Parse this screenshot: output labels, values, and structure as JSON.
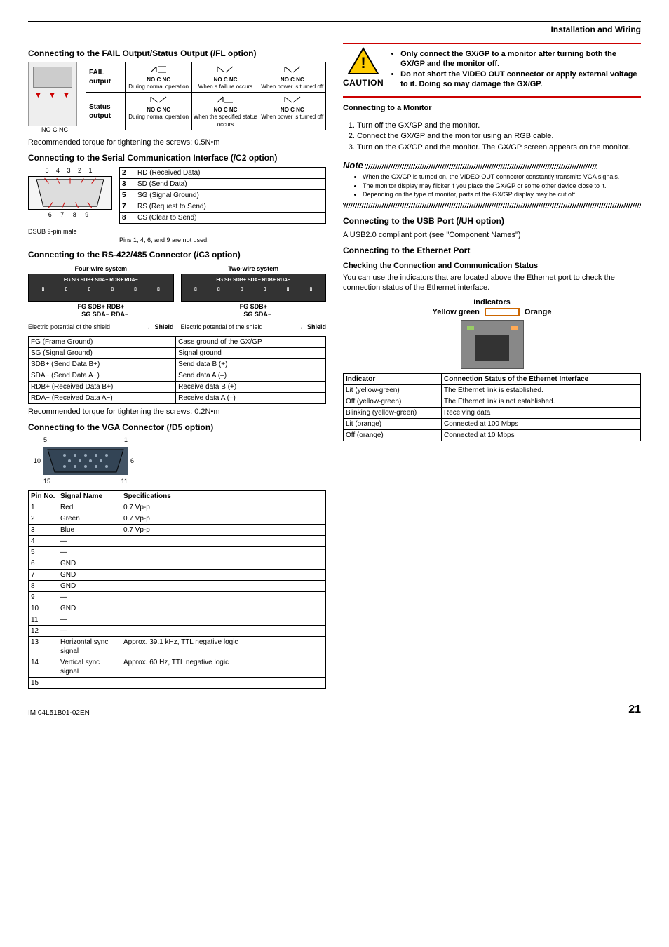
{
  "header": {
    "section": "Installation and Wiring"
  },
  "footer": {
    "doc": "IM 04L51B01-02EN",
    "page": "21"
  },
  "left": {
    "fail_title": "Connecting to the FAIL Output/Status Output (/FL option)",
    "terminal_labels": "NO  C  NC",
    "relay": {
      "row1_label": "FAIL output",
      "row2_label": "Status output",
      "hdr1": "NO C NC",
      "hdr2": "NO C NC",
      "hdr3": "NO C NC",
      "r1c1": "During normal operation",
      "r1c2": "When a failure occurs",
      "r1c3": "When power is turned off",
      "r2c1": "During normal operation",
      "r2c2": "When the specified status occurs",
      "r2c3": "When power is turned off"
    },
    "torque1": "Recommended torque for tightening the screws: 0.5N•m",
    "serial_title": "Connecting to the Serial Communication Interface (/C2 option)",
    "dsub_top": "5   4   3   2   1",
    "dsub_bottom": "6    7    8   9",
    "dsub_caption": "DSUB 9-pin male",
    "dsub_note": "Pins 1, 4, 6, and 9 are not used.",
    "serial_pins": [
      {
        "n": "2",
        "d": "RD (Received Data)"
      },
      {
        "n": "3",
        "d": "SD (Send Data)"
      },
      {
        "n": "5",
        "d": "SG (Signal Ground)"
      },
      {
        "n": "7",
        "d": "RS (Request to Send)"
      },
      {
        "n": "8",
        "d": "CS (Clear to Send)"
      }
    ],
    "rs_title": "Connecting to the RS-422/485 Connector (/C3 option)",
    "rs_four": "Four-wire system",
    "rs_two": "Two-wire system",
    "rs_block_labels": "FG   SG   SDB+  SDA−  RDB+ RDA−",
    "rs_four_lines1": "FG    SDB+  RDB+",
    "rs_four_lines2": "SG    SDA−  RDA−",
    "rs_two_lines1": "FG    SDB+",
    "rs_two_lines2": "SG    SDA−",
    "rs_shield": "Shield",
    "rs_potential": "Electric potential of the shield",
    "rs_signals": [
      {
        "a": "FG (Frame Ground)",
        "b": "Case ground of the GX/GP"
      },
      {
        "a": "SG (Signal Ground)",
        "b": "Signal ground"
      },
      {
        "a": "SDB+ (Send Data B+)",
        "b": "Send data B (+)"
      },
      {
        "a": "SDA− (Send Data A−)",
        "b": "Send data A (–)"
      },
      {
        "a": "RDB+ (Received Data B+)",
        "b": "Receive data B (+)"
      },
      {
        "a": "RDA− (Received Data A−)",
        "b": "Receive data A (–)"
      }
    ],
    "torque2": "Recommended torque for tightening the screws: 0.2N•m",
    "vga_title": "Connecting to the VGA Connector (/D5 option)",
    "vga_nums": {
      "tl": "5",
      "tr": "1",
      "ml": "10",
      "mr": "6",
      "bl": "15",
      "br": "11"
    },
    "vga_table_hdr": {
      "c1": "Pin No.",
      "c2": "Signal Name",
      "c3": "Specifications"
    },
    "vga_rows": [
      {
        "n": "1",
        "s": "Red",
        "p": "0.7 Vp-p"
      },
      {
        "n": "2",
        "s": "Green",
        "p": "0.7 Vp-p"
      },
      {
        "n": "3",
        "s": "Blue",
        "p": "0.7 Vp-p"
      },
      {
        "n": "4",
        "s": "—",
        "p": ""
      },
      {
        "n": "5",
        "s": "—",
        "p": ""
      },
      {
        "n": "6",
        "s": "GND",
        "p": ""
      },
      {
        "n": "7",
        "s": "GND",
        "p": ""
      },
      {
        "n": "8",
        "s": "GND",
        "p": ""
      },
      {
        "n": "9",
        "s": "—",
        "p": ""
      },
      {
        "n": "10",
        "s": "GND",
        "p": ""
      },
      {
        "n": "11",
        "s": "—",
        "p": ""
      },
      {
        "n": "12",
        "s": "—",
        "p": ""
      },
      {
        "n": "13",
        "s": "Horizontal sync signal",
        "p": "Approx. 39.1 kHz, TTL negative logic"
      },
      {
        "n": "14",
        "s": "Vertical sync signal",
        "p": "Approx. 60 Hz, TTL negative logic"
      },
      {
        "n": "15",
        "s": "",
        "p": ""
      }
    ]
  },
  "right": {
    "caution_label": "CAUTION",
    "caution_b1": "Only connect the GX/GP to a monitor after turning both the GX/GP and the monitor off.",
    "caution_b2": "Do not short the VIDEO OUT connector or apply external voltage to it. Doing so may damage the GX/GP.",
    "mon_title": "Connecting to a Monitor",
    "mon_1": "Turn off the GX/GP and the monitor.",
    "mon_2": "Connect the GX/GP and the monitor using an RGB cable.",
    "mon_3": "Turn on the GX/GP and the monitor. The GX/GP screen appears on the monitor.",
    "note_label": "Note",
    "note_1": "When the GX/GP is turned on, the VIDEO OUT connector constantly transmits VGA signals.",
    "note_2": "The monitor display may flicker if you place the GX/GP or some other device close to it.",
    "note_3": "Depending on the type of monitor, parts of the GX/GP display may be cut off.",
    "usb_title": "Connecting to the USB Port (/UH option)",
    "usb_text": "A USB2.0 compliant port (see \"Component Names\")",
    "eth_title": "Connecting to the Ethernet Port",
    "eth_sub": "Checking the Connection and Communication Status",
    "eth_text": "You can use the indicators that are located above the Ethernet port to check the connection status of the Ethernet interface.",
    "eth_ind": "Indicators",
    "eth_yg": "Yellow green",
    "eth_or": "Orange",
    "eth_hdr1": "Indicator",
    "eth_hdr2": "Connection Status of the Ethernet Interface",
    "eth_rows": [
      {
        "a": "Lit (yellow-green)",
        "b": "The Ethernet link is established."
      },
      {
        "a": "Off (yellow-green)",
        "b": "The Ethernet link is not established."
      },
      {
        "a": "Blinking (yellow-green)",
        "b": "Receiving data"
      },
      {
        "a": "Lit (orange)",
        "b": "Connected at 100 Mbps"
      },
      {
        "a": "Off (orange)",
        "b": "Connected at 10 Mbps"
      }
    ]
  }
}
